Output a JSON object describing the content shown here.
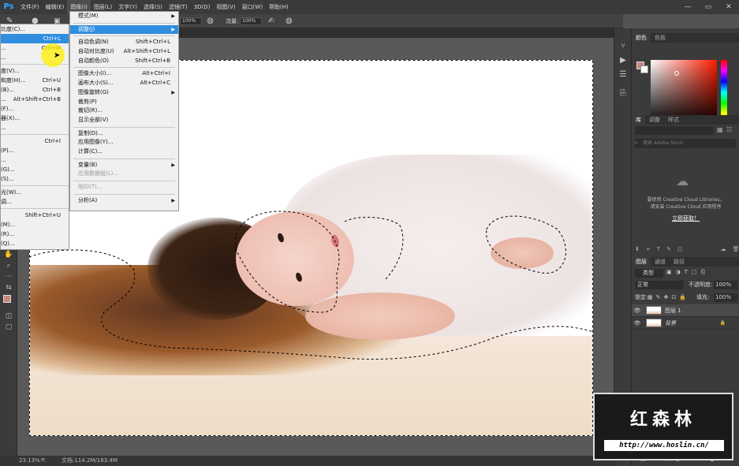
{
  "app": {
    "logo": "Ps"
  },
  "menubar": {
    "items": [
      "文件(F)",
      "编辑(E)",
      "图像(I)",
      "图层(L)",
      "文字(Y)",
      "选择(S)",
      "滤镜(T)",
      "3D(D)",
      "视图(V)",
      "窗口(W)",
      "帮助(H)"
    ],
    "active_index": 2
  },
  "window_controls": {
    "minimize": "—",
    "maximize": "▭",
    "close": "✕"
  },
  "options_bar": {
    "zoom1": "100%",
    "flow_label": "流量:",
    "flow_value": "100%"
  },
  "adjust_menu": {
    "items": [
      {
        "label": "比度(C)...",
        "shortcut": ""
      },
      {
        "label": "",
        "shortcut": "Ctrl+L",
        "highlight": true
      },
      {
        "label": "...",
        "shortcut": "Ctrl+M"
      },
      {
        "label": "...",
        "shortcut": ""
      },
      {
        "sep": true
      },
      {
        "label": "度(V)...",
        "shortcut": ""
      },
      {
        "label": "和度(H)...",
        "shortcut": "Ctrl+U"
      },
      {
        "label": "(B)...",
        "shortcut": "Ctrl+B"
      },
      {
        "label": "...",
        "shortcut": "Alt+Shift+Ctrl+B"
      },
      {
        "label": "(F)...",
        "shortcut": ""
      },
      {
        "label": "器(X)...",
        "shortcut": ""
      },
      {
        "label": "...",
        "shortcut": ""
      },
      {
        "sep": true
      },
      {
        "label": "",
        "shortcut": "Ctrl+I"
      },
      {
        "label": "(P)...",
        "shortcut": ""
      },
      {
        "label": "...",
        "shortcut": ""
      },
      {
        "label": "(G)...",
        "shortcut": ""
      },
      {
        "label": "(S)...",
        "shortcut": ""
      },
      {
        "sep": true
      },
      {
        "label": "光(W)...",
        "shortcut": ""
      },
      {
        "label": "调...",
        "shortcut": ""
      },
      {
        "sep": true
      },
      {
        "label": "",
        "shortcut": "Shift+Ctrl+U"
      },
      {
        "label": "(M)...",
        "shortcut": ""
      },
      {
        "label": "(R)...",
        "shortcut": ""
      },
      {
        "label": "(Q)...",
        "shortcut": ""
      }
    ]
  },
  "image_menu": {
    "items": [
      {
        "label": "模式(M)",
        "shortcut": "",
        "arrow": true
      },
      {
        "sep": true
      },
      {
        "label": "调整(J)",
        "shortcut": "",
        "arrow": true,
        "highlight": true
      },
      {
        "sep": true
      },
      {
        "label": "自动色调(N)",
        "shortcut": "Shift+Ctrl+L"
      },
      {
        "label": "自动对比度(U)",
        "shortcut": "Alt+Shift+Ctrl+L"
      },
      {
        "label": "自动颜色(O)",
        "shortcut": "Shift+Ctrl+B"
      },
      {
        "sep": true
      },
      {
        "label": "图像大小(I)...",
        "shortcut": "Alt+Ctrl+I"
      },
      {
        "label": "画布大小(S)...",
        "shortcut": "Alt+Ctrl+C"
      },
      {
        "label": "图像旋转(G)",
        "shortcut": "",
        "arrow": true
      },
      {
        "label": "裁剪(P)",
        "shortcut": ""
      },
      {
        "label": "裁切(R)...",
        "shortcut": ""
      },
      {
        "label": "显示全部(V)",
        "shortcut": ""
      },
      {
        "sep": true
      },
      {
        "label": "复制(D)...",
        "shortcut": ""
      },
      {
        "label": "应用图像(Y)...",
        "shortcut": ""
      },
      {
        "label": "计算(C)...",
        "shortcut": ""
      },
      {
        "sep": true
      },
      {
        "label": "变量(B)",
        "shortcut": "",
        "arrow": true
      },
      {
        "label": "应用数据组(L)...",
        "shortcut": "",
        "disabled": true
      },
      {
        "sep": true
      },
      {
        "label": "陷印(T)...",
        "shortcut": "",
        "disabled": true
      },
      {
        "sep": true
      },
      {
        "label": "分析(A)",
        "shortcut": "",
        "arrow": true
      }
    ]
  },
  "statusbar": {
    "zoom": "23.13%",
    "doc": "文档:114.2M/183.4M"
  },
  "color_panel": {
    "tabs": [
      "颜色",
      "色板"
    ],
    "fg": "#c9877a",
    "bg": "#ffffff"
  },
  "library_panel": {
    "tabs": [
      "库",
      "调整",
      "样式"
    ],
    "search_placeholder": "搜索 Adobe Stock",
    "message1": "要使用 Creative Cloud Libraries，",
    "message2": "请安装 Creative Cloud 应用程序",
    "link": "立即获取！"
  },
  "layers_panel": {
    "tabs": [
      "图层",
      "通道",
      "路径"
    ],
    "filter": "类型",
    "blend_mode": "正常",
    "opacity_label": "不透明度:",
    "opacity": "100%",
    "lock_label": "锁定:",
    "fill_label": "填充:",
    "fill": "100%",
    "layers": [
      {
        "name": "图层 1",
        "locked": false
      },
      {
        "name": "背景",
        "locked": true
      }
    ]
  },
  "watermark": {
    "title": "红森林",
    "url": "http://www.hoslin.cn/"
  }
}
